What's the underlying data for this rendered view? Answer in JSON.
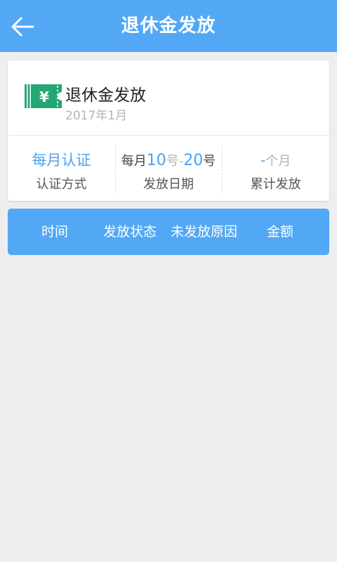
{
  "header": {
    "title": "退休金发放",
    "back_icon": "arrow-left-icon"
  },
  "card": {
    "icon": "ticket-yen-icon",
    "icon_symbol": "¥",
    "title": "退休金发放",
    "subtitle": "2017年1月",
    "stats": {
      "auth": {
        "value": "每月认证",
        "label": "认证方式"
      },
      "date": {
        "prefix": "每月",
        "start": "10",
        "start_unit": "号",
        "sep": "-",
        "end": "20",
        "end_unit": "号",
        "label": "发放日期"
      },
      "total": {
        "value": "-",
        "unit": "个月",
        "label": "累计发放"
      }
    }
  },
  "table": {
    "columns": [
      "时间",
      "发放状态",
      "未发放原因",
      "金额"
    ]
  },
  "colors": {
    "primary": "#52a8f5",
    "accent_text": "#4aa3f0",
    "icon_green": "#24a872",
    "background": "#eeeeee"
  }
}
